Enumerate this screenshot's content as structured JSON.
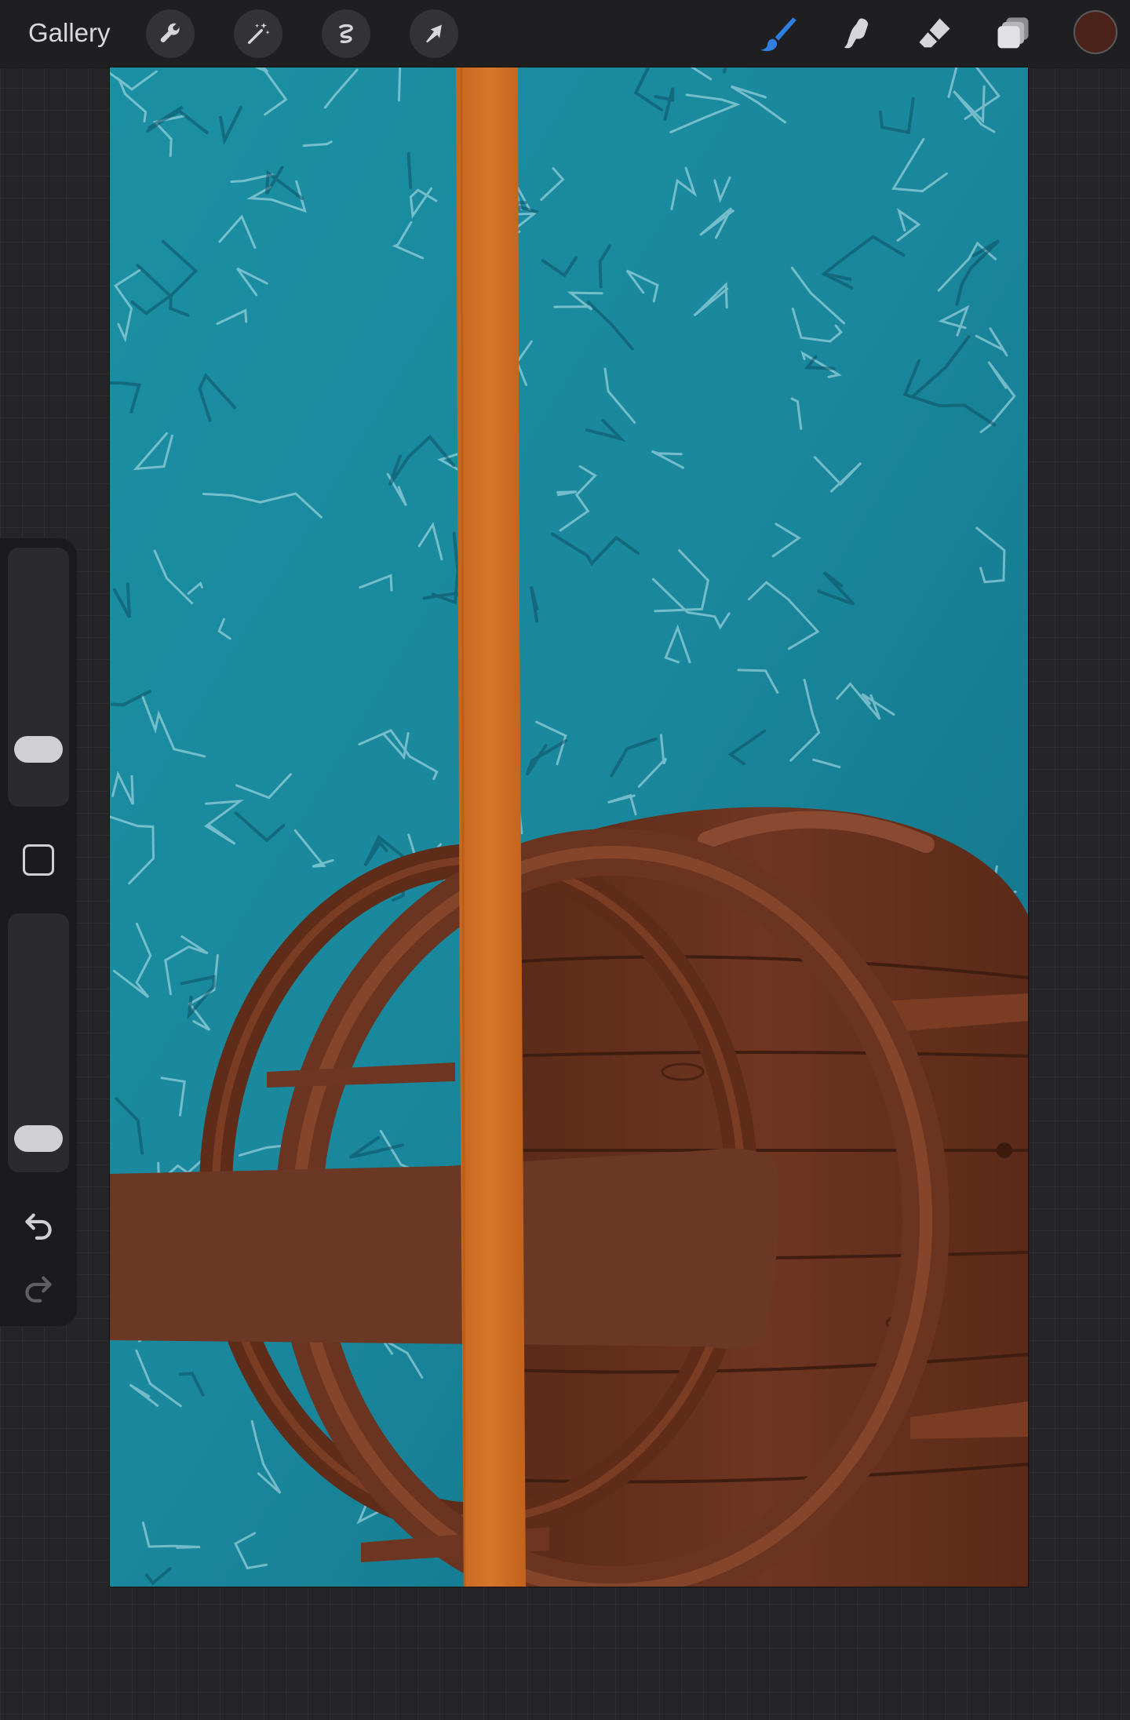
{
  "toolbar": {
    "gallery_label": "Gallery",
    "left_tools": [
      "wrench-icon",
      "magic-wand-icon",
      "selection-icon",
      "transform-arrow-icon"
    ],
    "right_tools": [
      "brush-icon",
      "smudge-icon",
      "eraser-icon",
      "layers-icon"
    ],
    "active_tool": "brush-icon",
    "active_tool_color": "#2f7fe0",
    "current_color": "#4a2219"
  },
  "sidebar": {
    "brush_size_level": 0.16,
    "opacity_level": 0.05,
    "modify_button": "square-icon",
    "undo": "undo-icon",
    "redo": "redo-icon",
    "redo_enabled": false
  },
  "canvas": {
    "layers": [
      "water-texture",
      "wooden-barrel",
      "orange-vertical-plank",
      "brown-horizontal-beam"
    ],
    "colors": {
      "water": "#1c8a9e",
      "water_highlight": "#bfe8ef",
      "water_shadow": "#0c4b5e",
      "wood_dark": "#4d2214",
      "wood_mid": "#6e3522",
      "wood_light": "#8a4a32",
      "beam": "#6a3824",
      "plank": "#d06f23"
    }
  }
}
